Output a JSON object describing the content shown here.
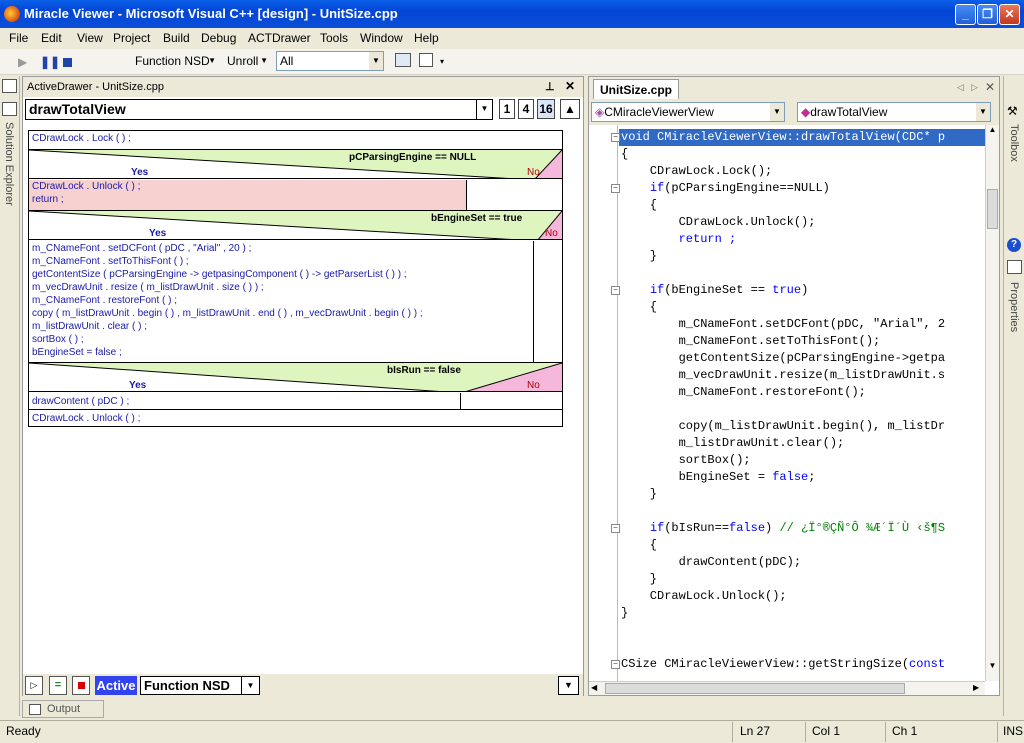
{
  "window": {
    "title": "Miracle Viewer - Microsoft Visual C++ [design] - UnitSize.cpp",
    "min_glyph": "_",
    "max_glyph": "❐",
    "close_glyph": "✕"
  },
  "menu": [
    "File",
    "Edit",
    "View",
    "Project",
    "Build",
    "Debug",
    "ACTDrawer",
    "Tools",
    "Window",
    "Help"
  ],
  "toolbar": {
    "function_nsd": "Function NSD",
    "unroll": "Unroll",
    "all": "All"
  },
  "left_tabs": {
    "solution_explorer": "Solution Explorer"
  },
  "right_tabs": {
    "toolbox": "Toolbox",
    "properties": "Properties"
  },
  "active_drawer": {
    "title": "ActiveDrawer - UnitSize.cpp",
    "pin_glyph": "⊥",
    "close_glyph": "✕",
    "function_name": "drawTotalView",
    "levels": [
      "1",
      "4",
      "16"
    ],
    "blocks": {
      "lock1": "CDrawLock . Lock ( ) ;",
      "cond1": "pCParsingEngine == NULL",
      "cond1_yes": "Yes",
      "cond1_no": "No",
      "cond1_body": "CDrawLock . Unlock ( ) ;\nreturn ;",
      "cond2": "bEngineSet == true",
      "cond2_yes": "Yes",
      "cond2_no": "No",
      "cond2_body": "m_CNameFont . setDCFont ( pDC , \"Arial\" , 20 ) ;\nm_CNameFont . setToThisFont ( ) ;\ngetContentSize ( pCParsingEngine -> getpasingComponent ( ) -> getParserList ( ) ) ;\nm_vecDrawUnit . resize ( m_listDrawUnit . size ( ) ) ;\nm_CNameFont . restoreFont ( ) ;\ncopy ( m_listDrawUnit . begin ( ) , m_listDrawUnit . end ( ) , m_vecDrawUnit . begin ( ) ) ;\nm_listDrawUnit . clear ( ) ;\nsortBox ( ) ;\nbEngineSet = false ;",
      "cond3": "bIsRun == false",
      "cond3_yes": "Yes",
      "cond3_no": "No",
      "cond3_body": "drawContent ( pDC ) ;",
      "unlock_final": "CDrawLock . Unlock ( ) ;"
    },
    "bottom": {
      "active": "Active",
      "mode": "Function NSD"
    }
  },
  "output_tab": "Output",
  "editor": {
    "tab": "UnitSize.cpp",
    "class_combo": "CMiracleViewerView",
    "method_combo": "drawTotalView",
    "lines": [
      "void CMiracleViewerView::drawTotalView(CDC* p",
      "{",
      "    CDrawLock.Lock();",
      "    if(pCParsingEngine==NULL)",
      "    {",
      "        CDrawLock.Unlock();",
      "        return ;",
      "    }",
      "",
      "    if(bEngineSet == true)",
      "    {",
      "        m_CNameFont.setDCFont(pDC, \"Arial\", 2",
      "        m_CNameFont.setToThisFont();",
      "        getContentSize(pCParsingEngine->getpa",
      "        m_vecDrawUnit.resize(m_listDrawUnit.s",
      "        m_CNameFont.restoreFont();",
      "",
      "        copy(m_listDrawUnit.begin(), m_listDr",
      "        m_listDrawUnit.clear();",
      "        sortBox();",
      "        bEngineSet = false;",
      "    }",
      "",
      "    if(bIsRun==false) // ¿Ï°®ÇÑ°Ô ¾Æ´Ï´Ù ‹š¶S",
      "    {",
      "        drawContent(pDC);",
      "    }",
      "    CDrawLock.Unlock();",
      "}",
      "",
      "",
      "CSize CMiracleViewerView::getStringSize(const"
    ]
  },
  "status": {
    "ready": "Ready",
    "ln": "Ln 27",
    "col": "Col 1",
    "ch": "Ch 1",
    "ins": "INS"
  },
  "colors": {
    "cond_green": "#dff5c0",
    "cond_pink": "#f5b8dc",
    "yes_body_pink": "#f7d0d0",
    "selection": "#316ac5",
    "active_blue": "#3344ee"
  }
}
